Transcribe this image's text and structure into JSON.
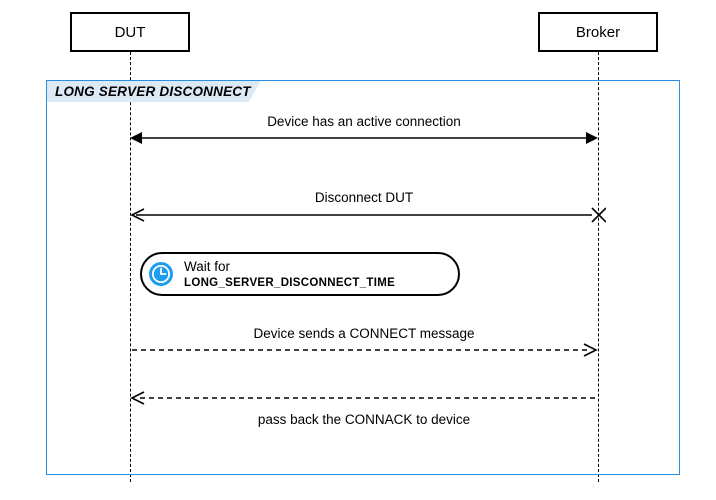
{
  "participants": {
    "dut": {
      "label": "DUT"
    },
    "broker": {
      "label": "Broker"
    }
  },
  "frame": {
    "title": "LONG SERVER DISCONNECT"
  },
  "messages": {
    "active_conn": "Device has an active connection",
    "disconnect": "Disconnect DUT",
    "wait_prefix": "Wait for ",
    "wait_const": "LONG_SERVER_DISCONNECT_TIME",
    "connect": "Device sends a CONNECT message",
    "connack": "pass back the CONNACK to device"
  },
  "colors": {
    "frame_border": "#2a8fe0",
    "frame_label_bg": "#dce9f7",
    "clock_accent": "#1e9df0"
  },
  "chart_data": {
    "type": "sequence_diagram",
    "participants": [
      "DUT",
      "Broker"
    ],
    "fragment": {
      "kind": "frame",
      "label": "LONG SERVER DISCONNECT"
    },
    "interactions": [
      {
        "from": "DUT",
        "to": "Broker",
        "style": "solid",
        "bidirectional": true,
        "label": "Device has an active connection"
      },
      {
        "from": "Broker",
        "to": "DUT",
        "style": "solid",
        "arrowhead": "open-cross",
        "label": "Disconnect DUT"
      },
      {
        "at": "DUT",
        "kind": "wait",
        "label": "Wait for LONG_SERVER_DISCONNECT_TIME"
      },
      {
        "from": "DUT",
        "to": "Broker",
        "style": "dashed",
        "label": "Device sends a CONNECT message"
      },
      {
        "from": "Broker",
        "to": "DUT",
        "style": "dashed",
        "label": "pass back the CONNACK to device"
      }
    ]
  }
}
